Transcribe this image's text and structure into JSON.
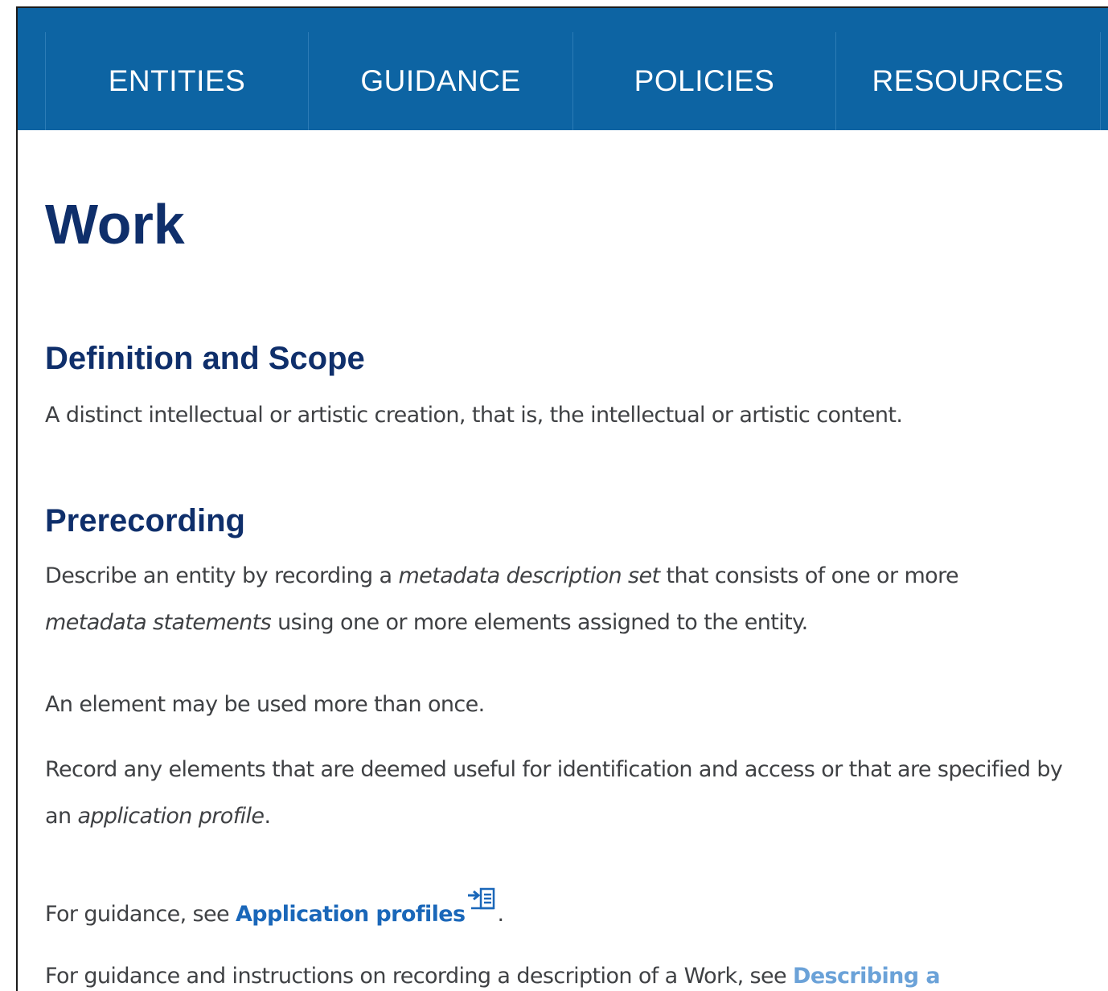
{
  "nav": {
    "items": [
      {
        "label": "ENTITIES"
      },
      {
        "label": "GUIDANCE"
      },
      {
        "label": "POLICIES"
      },
      {
        "label": "RESOURCES"
      }
    ]
  },
  "page": {
    "title": "Work"
  },
  "definition": {
    "heading": "Definition and Scope",
    "text": "A distinct intellectual or artistic creation, that is, the intellectual or artistic content."
  },
  "prerecording": {
    "heading": "Prerecording",
    "p1_part1": "Describe an entity by recording a ",
    "p1_em1": "metadata description set",
    "p1_part2": " that consists of one or more ",
    "p1_em2": "metadata statements",
    "p1_part3": " using one or more elements assigned to the entity.",
    "p2": "An element may be used more than once.",
    "p3_part1": "Record any elements that are deemed useful for identification and access or that are specified by an ",
    "p3_em": "application profile",
    "p3_part2": ".",
    "p4_part1": "For guidance, see ",
    "p4_link": "Application profiles",
    "p4_part2": ".",
    "p5_part1": "For guidance and instructions on recording a description of a Work, see ",
    "p5_link": "Describing a"
  },
  "icons": {
    "external_link": "internal-link-icon"
  },
  "colors": {
    "nav_background": "#0d64a3",
    "heading": "#0f2f6b",
    "link": "#1a67b9",
    "body_text": "#3f4144"
  }
}
